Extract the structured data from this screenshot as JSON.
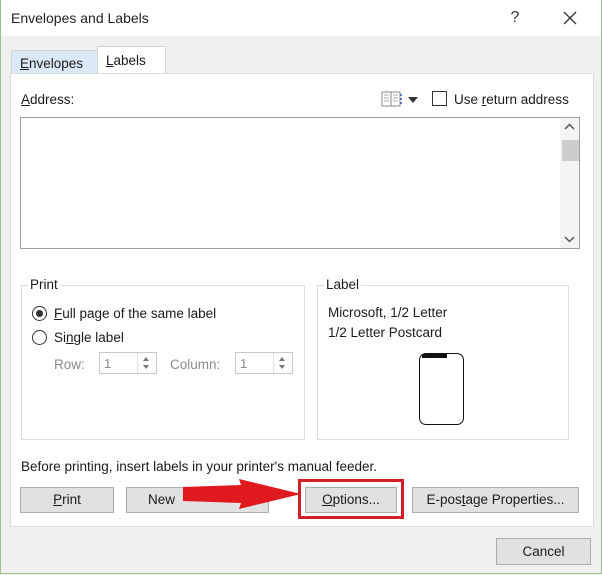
{
  "window": {
    "title": "Envelopes and Labels",
    "help_label": "?",
    "close_icon": "close-icon"
  },
  "tabs": [
    {
      "label_prefix": "",
      "mnemonic": "E",
      "label_rest": "nvelopes",
      "active": false
    },
    {
      "label_prefix": "",
      "mnemonic": "L",
      "label_rest": "abels",
      "active": true
    }
  ],
  "address": {
    "label_mnemonic": "A",
    "label_rest": "ddress:",
    "value": "",
    "address_book_icon": "address-book-icon",
    "use_return_address": {
      "pre": "Use ",
      "mnemonic": "r",
      "post": "eturn address",
      "checked": false
    }
  },
  "print_group": {
    "title": "Print",
    "options": [
      {
        "mnemonic": "F",
        "rest": "ull page of the same label",
        "pre": "",
        "selected": true
      },
      {
        "pre": "Si",
        "mnemonic": "n",
        "rest": "gle label",
        "selected": false
      }
    ],
    "row_label": "Row:",
    "row_value": "1",
    "column_label": "Column:",
    "column_value": "1"
  },
  "label_group": {
    "title": "Label",
    "vendor": "Microsoft, 1/2 Letter",
    "product": "1/2 Letter Postcard"
  },
  "note": "Before printing, insert labels in your printer's manual feeder.",
  "buttons": {
    "print": {
      "pre": "",
      "mnemonic": "P",
      "post": "rint"
    },
    "new_document": {
      "label": "New"
    },
    "options": {
      "pre": "",
      "mnemonic": "O",
      "post": "ptions..."
    },
    "epostage": {
      "pre": "E-pos",
      "mnemonic": "t",
      "post": "age Properties..."
    },
    "cancel": {
      "label": "Cancel"
    }
  },
  "annotation": {
    "highlight_color": "#d0202a",
    "arrow_color": "#e0191f",
    "target": "Options..."
  }
}
